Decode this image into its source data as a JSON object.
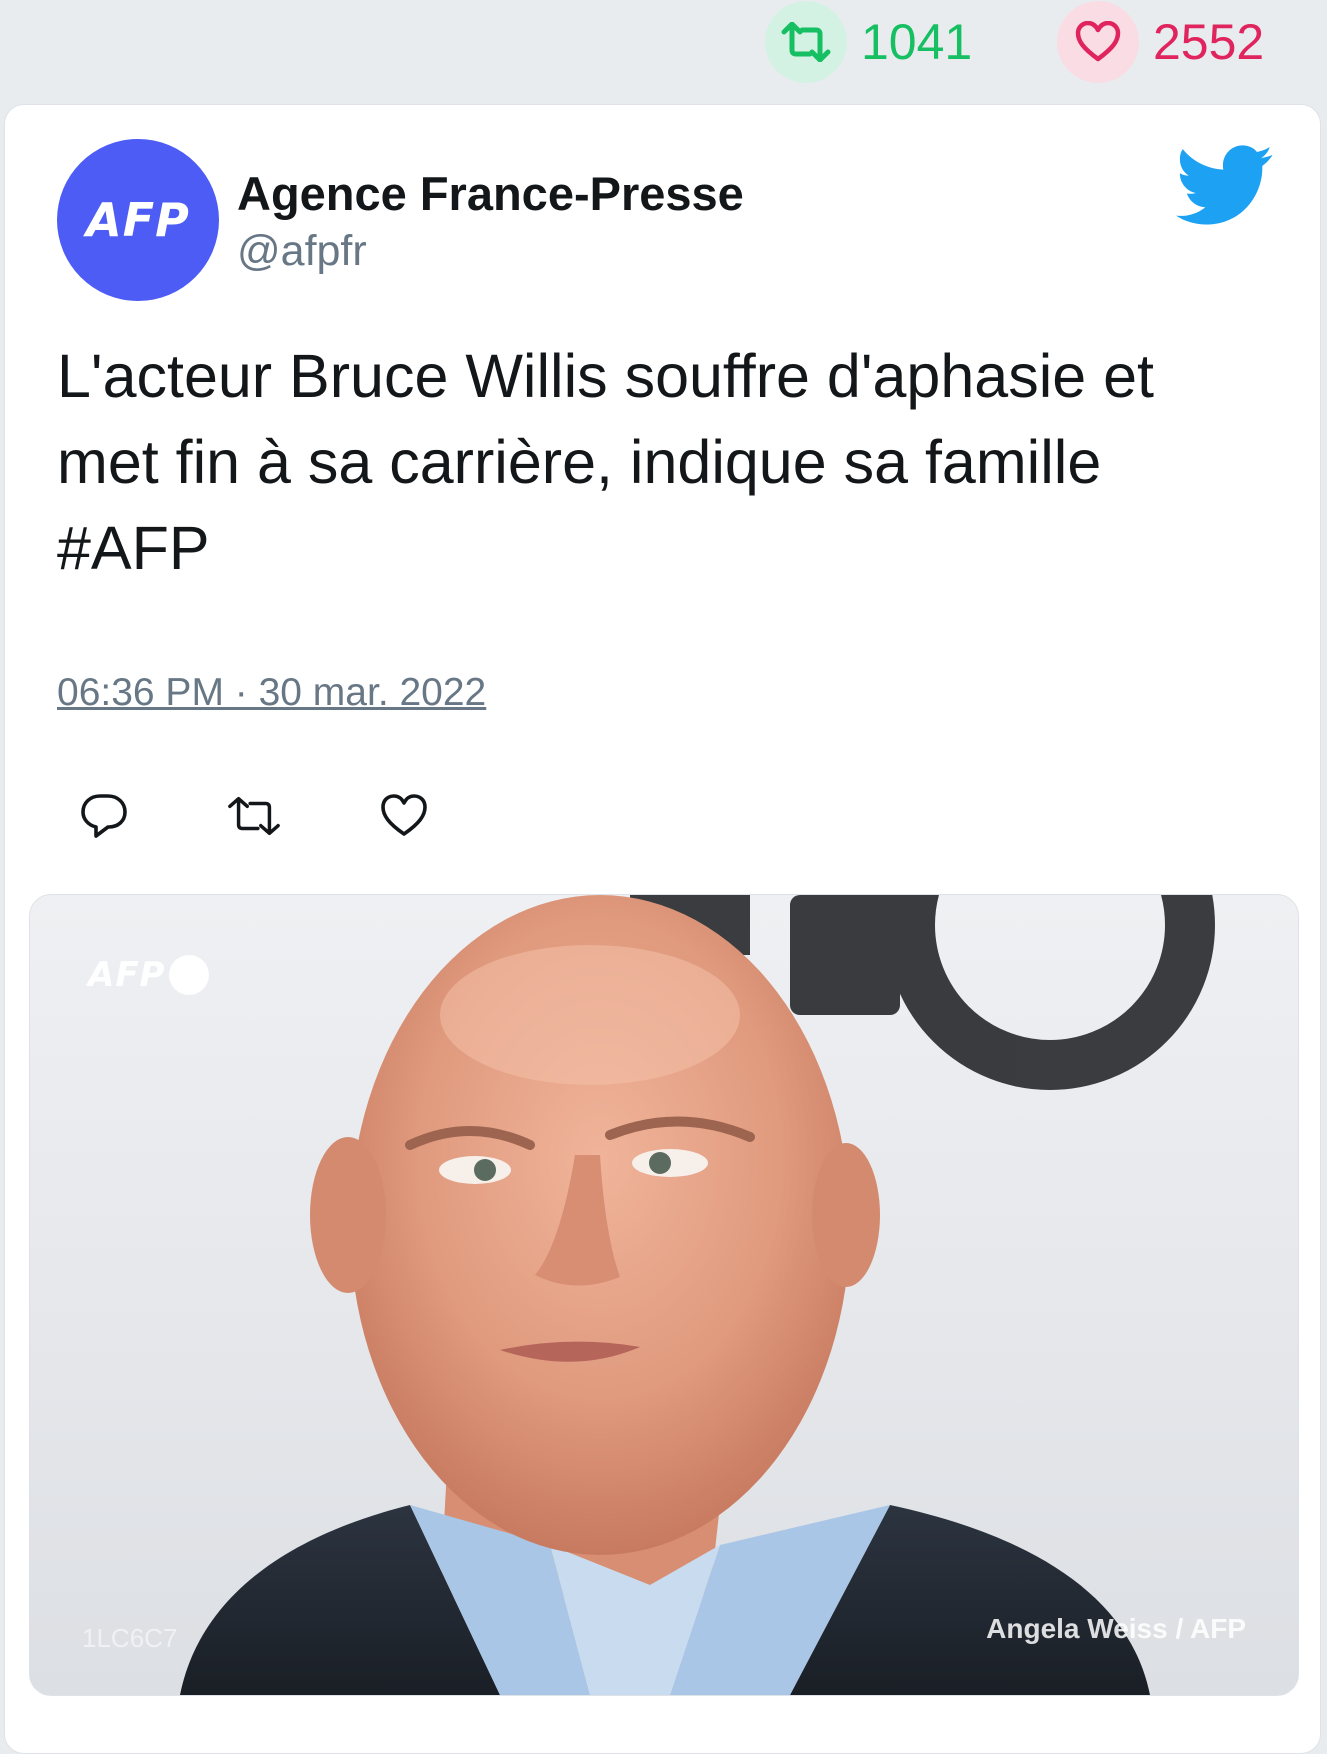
{
  "stats": {
    "retweet_count": "1041",
    "like_count": "2552",
    "retweet_icon": "retweet-icon",
    "like_icon": "heart-icon",
    "retweet_color": "#17bf63",
    "like_color": "#e0245e"
  },
  "tweet": {
    "avatar_text": "AFP",
    "author_name": "Agence France-Presse",
    "author_handle": "@afpfr",
    "platform_icon": "twitter-bird-icon",
    "text_lines": [
      "L'acteur Bruce Willis souffre d'aphasie et",
      "met fin à sa carrière, indique sa famille",
      "#AFP"
    ],
    "timestamp": "06:36 PM · 30 mar. 2022",
    "actions": [
      "reply-icon",
      "retweet-icon",
      "heart-icon"
    ],
    "brand_color": "#1da1f2",
    "avatar_color": "#4c5cf5"
  },
  "photo": {
    "watermark": "AFP",
    "code": "1LC6C7",
    "credit": "Angela Weiss / AFP",
    "backdrop_logo": "HBO"
  }
}
